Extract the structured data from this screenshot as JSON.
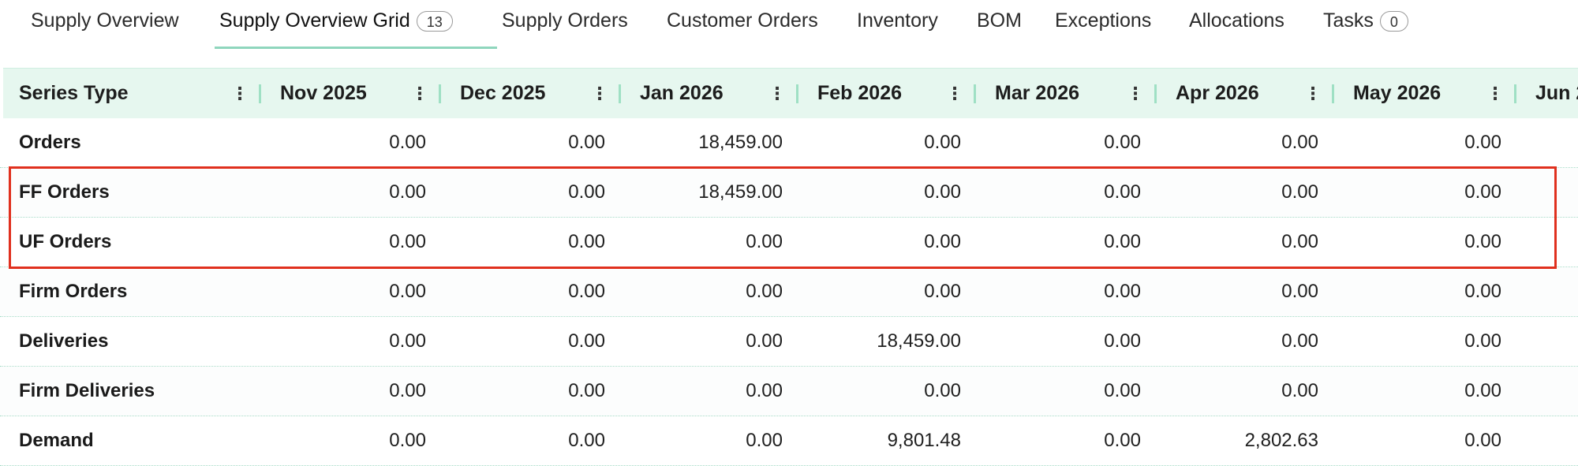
{
  "tabs": [
    {
      "label": "Supply Overview"
    },
    {
      "label": "Supply Overview Grid",
      "badge": "13"
    },
    {
      "label": "Supply Orders"
    },
    {
      "label": "Customer Orders"
    },
    {
      "label": "Inventory"
    },
    {
      "label": "BOM"
    },
    {
      "label": "Exceptions"
    },
    {
      "label": "Allocations"
    },
    {
      "label": "Tasks",
      "badge": "0"
    }
  ],
  "grid": {
    "header": {
      "series": "Series Type",
      "months": [
        "Nov 2025",
        "Dec 2025",
        "Jan 2026",
        "Feb 2026",
        "Mar 2026",
        "Apr 2026",
        "May 2026",
        "Jun 2"
      ]
    },
    "rows": [
      {
        "label": "Orders",
        "values": [
          "0.00",
          "0.00",
          "18,459.00",
          "0.00",
          "0.00",
          "0.00",
          "0.00"
        ]
      },
      {
        "label": "FF Orders",
        "values": [
          "0.00",
          "0.00",
          "18,459.00",
          "0.00",
          "0.00",
          "0.00",
          "0.00"
        ]
      },
      {
        "label": "UF Orders",
        "values": [
          "0.00",
          "0.00",
          "0.00",
          "0.00",
          "0.00",
          "0.00",
          "0.00"
        ]
      },
      {
        "label": "Firm Orders",
        "values": [
          "0.00",
          "0.00",
          "0.00",
          "0.00",
          "0.00",
          "0.00",
          "0.00"
        ]
      },
      {
        "label": "Deliveries",
        "values": [
          "0.00",
          "0.00",
          "0.00",
          "18,459.00",
          "0.00",
          "0.00",
          "0.00"
        ]
      },
      {
        "label": "Firm Deliveries",
        "values": [
          "0.00",
          "0.00",
          "0.00",
          "0.00",
          "0.00",
          "0.00",
          "0.00"
        ]
      },
      {
        "label": "Demand",
        "values": [
          "0.00",
          "0.00",
          "0.00",
          "9,801.48",
          "0.00",
          "2,802.63",
          "0.00"
        ]
      }
    ]
  },
  "colors": {
    "accent": "#8fd6bd",
    "header_bg": "#e6f7ef",
    "highlight": "#e0301e"
  }
}
